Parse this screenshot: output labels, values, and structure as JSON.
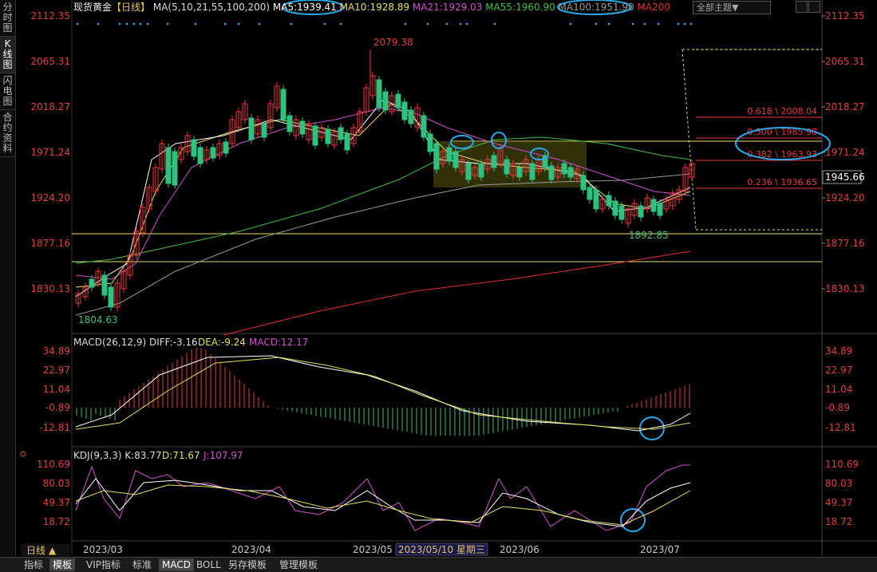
{
  "left_tabs": [
    {
      "label": "分时图"
    },
    {
      "label": "K线图"
    },
    {
      "label": "闪电图"
    },
    {
      "label": "合约资料"
    }
  ],
  "header": {
    "instrument": "现货黄金",
    "period": "【日线】",
    "ma_items": [
      {
        "text": "MA(5,10,21,55,100,200)",
        "color": "#dddddd"
      },
      {
        "text": "MA5:1939.41",
        "color": "#ffffff"
      },
      {
        "text": "MA10:1928.89",
        "color": "#e6e060"
      },
      {
        "text": "MA21:1929.03",
        "color": "#d050d0"
      },
      {
        "text": "MA55:1960.90",
        "color": "#40c040"
      },
      {
        "text": "MA100:1951.90",
        "color": "#999999"
      },
      {
        "text": "MA200",
        "color": "#e03030"
      }
    ],
    "theme_button": "全部主题▼"
  },
  "price_axis": {
    "labels": [
      "2112.35",
      "2065.31",
      "2018.27",
      "1971.24",
      "1924.20",
      "1877.16",
      "1830.13"
    ],
    "current": "1945.66"
  },
  "annotations": {
    "high": "2079.38",
    "low": "1804.63",
    "mid_low": "1892.85",
    "fibs": [
      {
        "label": "0.618 \\ 2008.04"
      },
      {
        "label": "0.500 \\ 1985.98"
      },
      {
        "label": "0.382 \\ 1963.93"
      },
      {
        "label": "0.236 \\ 1936.65"
      }
    ]
  },
  "macd": {
    "title": "MACD(26,12,9)",
    "diff": "DIFF:-3.16",
    "dea": "DEA:-9.24",
    "macd": "MACD:12.17",
    "axis": [
      "34.89",
      "22.97",
      "11.04",
      "-0.89",
      "-12.81"
    ]
  },
  "kdj": {
    "title": "KDJ(9,3,3)",
    "k": "K:83.77",
    "d": "D:71.67",
    "j": "J:107.97",
    "axis": [
      "110.69",
      "80.03",
      "49.37",
      "18.72"
    ]
  },
  "time_axis": {
    "period_btn": "日线 ▲",
    "labels": [
      "2023/03",
      "2023/04",
      "2023/05",
      "2023/06",
      "2023/07"
    ],
    "highlight": "2023/05/10 星期三"
  },
  "bottom_tabs": [
    {
      "label": "指标"
    },
    {
      "label": "模板"
    },
    {
      "label": "VIP指标"
    },
    {
      "label": "标准"
    },
    {
      "label": "MACD"
    },
    {
      "label": "BOLL"
    },
    {
      "label": "另存模板"
    },
    {
      "label": "管理模板"
    }
  ],
  "colors": {
    "up": "#e83a3a",
    "down": "#30c080",
    "fib": "#e83a3a",
    "hline": "#e6e060",
    "circle": "#2aa8e8"
  }
}
